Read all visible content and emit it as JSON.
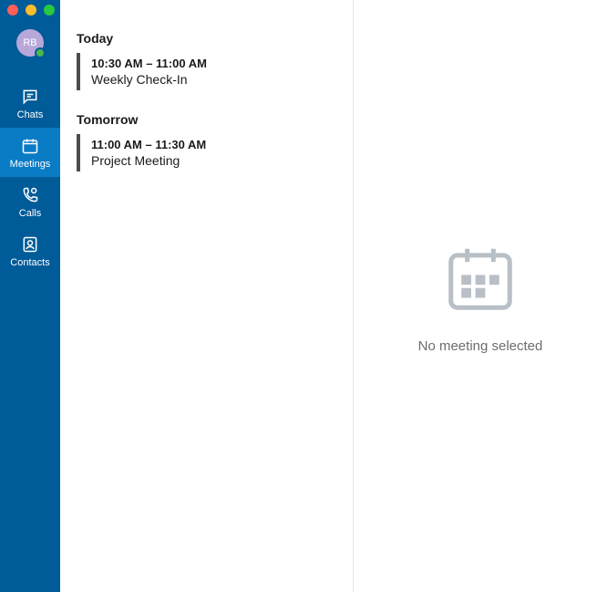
{
  "avatar": {
    "initials": "RB"
  },
  "sidebar": {
    "items": [
      {
        "id": "chats",
        "label": "Chats",
        "icon": "chat-icon",
        "active": false
      },
      {
        "id": "meetings",
        "label": "Meetings",
        "icon": "calendar-icon",
        "active": true
      },
      {
        "id": "calls",
        "label": "Calls",
        "icon": "phone-icon",
        "active": false
      },
      {
        "id": "contacts",
        "label": "Contacts",
        "icon": "contact-icon",
        "active": false
      }
    ]
  },
  "meetings": {
    "sections": [
      {
        "header": "Today",
        "items": [
          {
            "time": "10:30 AM – 11:00 AM",
            "title": "Weekly Check-In"
          }
        ]
      },
      {
        "header": "Tomorrow",
        "items": [
          {
            "time": "11:00 AM – 11:30 AM",
            "title": "Project Meeting"
          }
        ]
      }
    ]
  },
  "detail": {
    "empty_message": "No meeting selected"
  }
}
